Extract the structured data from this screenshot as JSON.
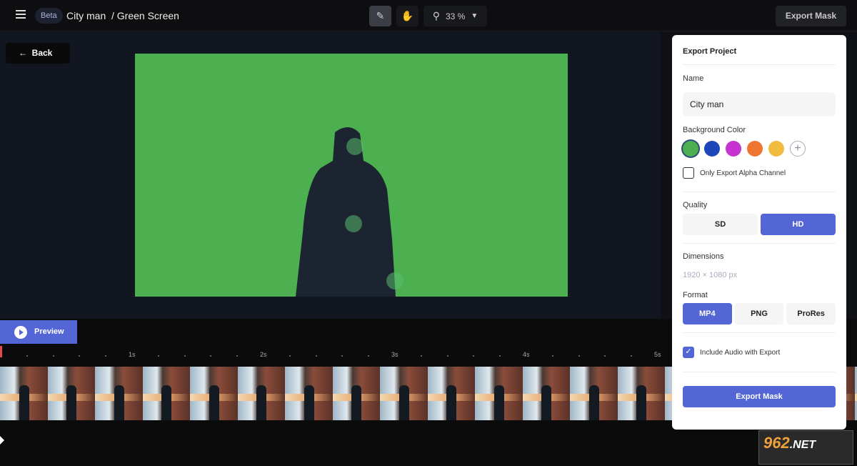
{
  "header": {
    "beta": "Beta",
    "project": "City man",
    "breadcrumb": "/ Green Screen",
    "zoom": "33 %",
    "export_label": "Export Mask"
  },
  "icons": [
    "menu-icon",
    "annotate-icon",
    "hand-icon",
    "magnifier-icon",
    "caret-down-icon",
    "arrow-left-icon",
    "play-icon",
    "plus-icon",
    "check-icon"
  ],
  "stage": {
    "back_label": "Back",
    "background_color": "#4caf50"
  },
  "timeline": {
    "preview_label": "Preview",
    "ticks": [
      "1s",
      "2s",
      "3s",
      "4s",
      "5s"
    ]
  },
  "export_panel": {
    "title": "Export Project",
    "name_label": "Name",
    "name_value": "City man",
    "bg_label": "Background Color",
    "colors": [
      "#4caf50",
      "#1d47b8",
      "#c733d0",
      "#ee7631",
      "#f2bc3f"
    ],
    "selected_color": "#4caf50",
    "alpha_label": "Only Export Alpha Channel",
    "alpha_checked": false,
    "quality_label": "Quality",
    "quality_options": [
      "SD",
      "HD"
    ],
    "quality_selected": "HD",
    "dimensions_label": "Dimensions",
    "dimensions_value": "1920 × 1080 px",
    "format_label": "Format",
    "format_options": [
      "MP4",
      "PNG",
      "ProRes"
    ],
    "format_selected": "MP4",
    "audio_label": "Include Audio with Export",
    "audio_checked": true,
    "export_button": "Export Mask"
  },
  "watermark": {
    "brand": "962",
    "tld": ".NET"
  }
}
